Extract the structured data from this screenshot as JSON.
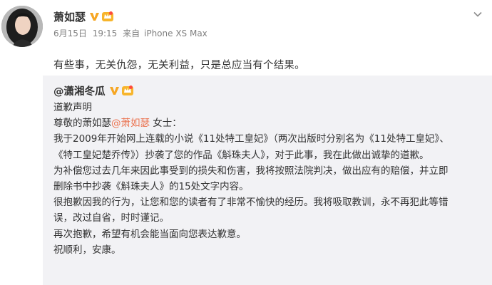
{
  "post": {
    "author": "萧如瑟",
    "date": "6月15日",
    "time": "19:15",
    "source_prefix": "来自",
    "source_device": "iPhone XS Max",
    "text": "有些事，无关仇怨，无关利益，只是总应当有个结果。"
  },
  "repost": {
    "at_symbol": "@",
    "author": "潇湘冬瓜",
    "title": "道歉声明",
    "salutation_prefix": "尊敬的萧如瑟",
    "salutation_mention": "@萧如瑟",
    "salutation_suffix": " 女士：",
    "lines": [
      "我于2009年开始网上连载的小说《11处特工皇妃》（两次出版时分别名为《11处特工皇妃》、",
      "《特工皇妃楚乔传》）抄袭了您的作品《斛珠夫人》，对于此事，我在此做出诚挚的道歉。",
      "为补偿您过去几年来因此事受到的损失和伤害，我将按照法院判决，做出应有的赔偿，并立即",
      "删除书中抄袭《斛珠夫人》的15处文字内容。",
      "很抱歉因我的行为，让您和您的读者有了非常不愉快的经历。我将吸取教训，永不再犯此等错",
      "误，改过自省，时时谨记。",
      "再次抱歉，希望有机会能当面向您表达歉意。",
      "祝顺利，安康。"
    ]
  },
  "colors": {
    "accent_mention": "#eb7350",
    "verified_badge": "#f6a623",
    "repost_background": "#f2f2f5",
    "meta_text": "#808080"
  },
  "icons": {
    "verified": "verified-v-icon",
    "vip": "vip-crown-icon",
    "more": "chevron-down-icon"
  }
}
